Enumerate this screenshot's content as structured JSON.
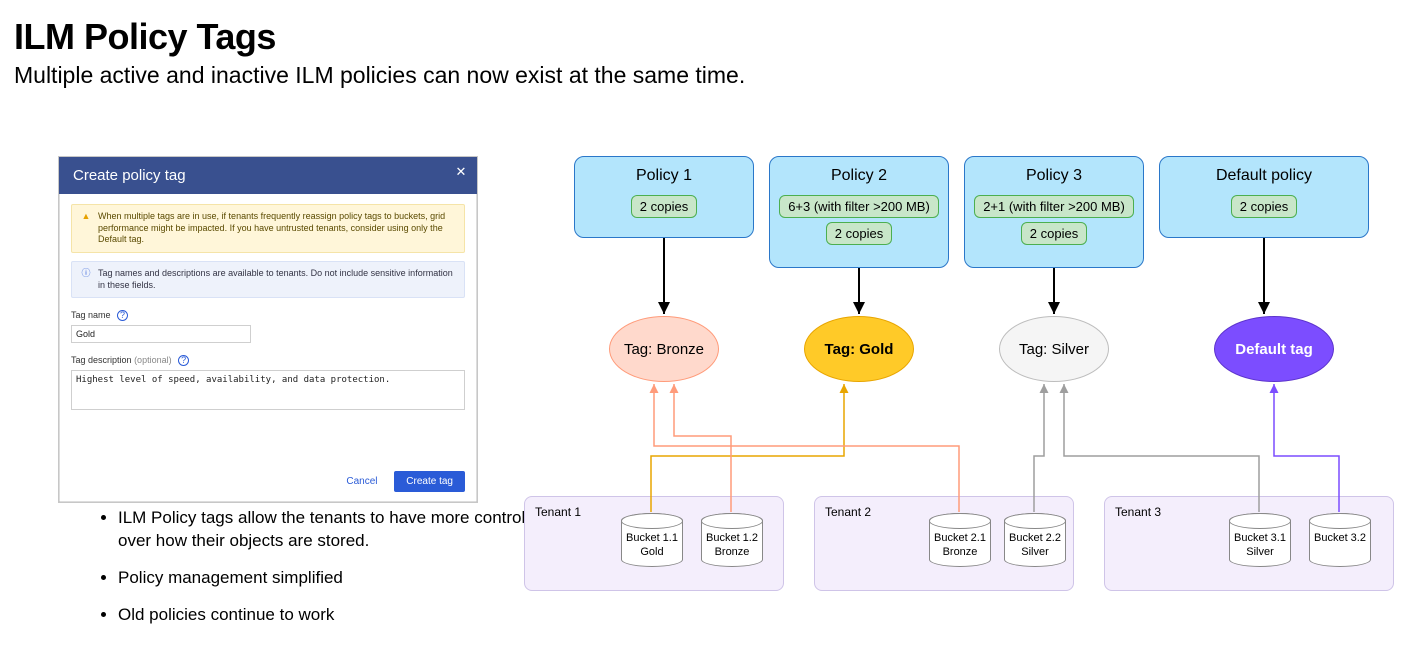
{
  "title": "ILM Policy Tags",
  "subtitle": "Multiple active and inactive ILM policies can now exist at the same time.",
  "modal": {
    "title": "Create policy tag",
    "alert_warn": "When multiple tags are in use, if tenants frequently reassign policy tags to buckets, grid performance might be impacted. If you have untrusted tenants, consider using only the Default tag.",
    "alert_info": "Tag names and descriptions are available to tenants. Do not include sensitive information in these fields.",
    "tag_name_label": "Tag name",
    "tag_name_value": "Gold",
    "tag_desc_label": "Tag description",
    "tag_desc_optional": "(optional)",
    "tag_desc_value": "Highest level of speed, availability, and data protection.",
    "cancel": "Cancel",
    "create": "Create tag"
  },
  "bullets": [
    "ILM Policy tags allow the tenants to have more control over how their objects are stored.",
    "Policy management simplified",
    "Old policies continue to work"
  ],
  "policies": {
    "p1": {
      "title": "Policy 1",
      "chips": [
        "2 copies"
      ]
    },
    "p2": {
      "title": "Policy 2",
      "chips": [
        "6+3 (with filter >200 MB)",
        "2 copies"
      ]
    },
    "p3": {
      "title": "Policy 3",
      "chips": [
        "2+1 (with filter >200 MB)",
        "2 copies"
      ]
    },
    "p4": {
      "title": "Default policy",
      "chips": [
        "2 copies"
      ]
    }
  },
  "tags": {
    "bronze": "Tag: Bronze",
    "gold": "Tag: Gold",
    "silver": "Tag: Silver",
    "default": "Default tag"
  },
  "tenants": {
    "t1": {
      "label": "Tenant 1",
      "b1": "Bucket 1.1\nGold",
      "b2": "Bucket 1.2\nBronze"
    },
    "t2": {
      "label": "Tenant 2",
      "b1": "Bucket 2.1\nBronze",
      "b2": "Bucket 2.2\nSilver"
    },
    "t3": {
      "label": "Tenant 3",
      "b1": "Bucket 3.1\nSilver",
      "b2": "Bucket 3.2"
    }
  },
  "chart_data": {
    "type": "diagram",
    "nodes": {
      "policies": [
        {
          "id": "p1",
          "name": "Policy 1",
          "rules": [
            "2 copies"
          ]
        },
        {
          "id": "p2",
          "name": "Policy 2",
          "rules": [
            "6+3 (with filter >200 MB)",
            "2 copies"
          ]
        },
        {
          "id": "p3",
          "name": "Policy 3",
          "rules": [
            "2+1 (with filter >200 MB)",
            "2 copies"
          ]
        },
        {
          "id": "p4",
          "name": "Default policy",
          "rules": [
            "2 copies"
          ]
        }
      ],
      "tags": [
        {
          "id": "bronze",
          "name": "Tag: Bronze"
        },
        {
          "id": "gold",
          "name": "Tag: Gold"
        },
        {
          "id": "silver",
          "name": "Tag: Silver"
        },
        {
          "id": "default",
          "name": "Default tag"
        }
      ],
      "tenants": [
        {
          "id": "t1",
          "name": "Tenant 1",
          "buckets": [
            {
              "id": "b11",
              "name": "Bucket 1.1",
              "tag": "gold"
            },
            {
              "id": "b12",
              "name": "Bucket 1.2",
              "tag": "bronze"
            }
          ]
        },
        {
          "id": "t2",
          "name": "Tenant 2",
          "buckets": [
            {
              "id": "b21",
              "name": "Bucket 2.1",
              "tag": "bronze"
            },
            {
              "id": "b22",
              "name": "Bucket 2.2",
              "tag": "silver"
            }
          ]
        },
        {
          "id": "t3",
          "name": "Tenant 3",
          "buckets": [
            {
              "id": "b31",
              "name": "Bucket 3.1",
              "tag": "silver"
            },
            {
              "id": "b32",
              "name": "Bucket 3.2",
              "tag": "default"
            }
          ]
        }
      ]
    },
    "edges": [
      {
        "from": "p1",
        "to": "bronze"
      },
      {
        "from": "p2",
        "to": "gold"
      },
      {
        "from": "p3",
        "to": "silver"
      },
      {
        "from": "p4",
        "to": "default"
      },
      {
        "from": "b11",
        "to": "gold"
      },
      {
        "from": "b12",
        "to": "bronze"
      },
      {
        "from": "b21",
        "to": "bronze"
      },
      {
        "from": "b22",
        "to": "silver"
      },
      {
        "from": "b31",
        "to": "silver"
      },
      {
        "from": "b32",
        "to": "default"
      }
    ]
  }
}
